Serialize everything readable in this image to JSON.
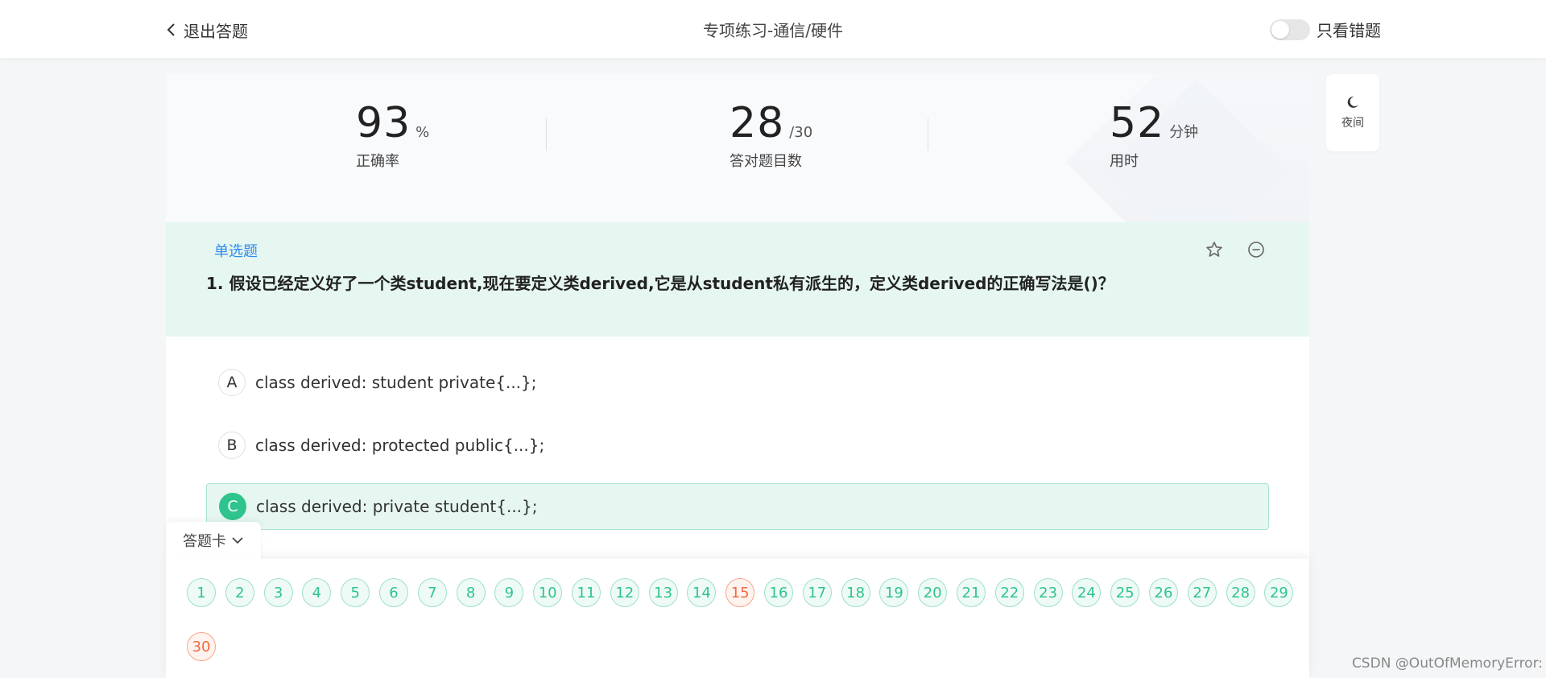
{
  "header": {
    "back_label": "退出答题",
    "title": "专项练习-通信/硬件",
    "wrong_only_label": "只看错题",
    "wrong_only_on": false
  },
  "stats": [
    {
      "value": "93",
      "unit": "%",
      "label": "正确率"
    },
    {
      "value": "28",
      "unit": "/30",
      "label": "答对题目数"
    },
    {
      "value": "52",
      "unit": "分钟",
      "label": "用时"
    }
  ],
  "question": {
    "type": "单选题",
    "text": "1. 假设已经定义好了一个类student,现在要定义类derived,它是从student私有派生的，定义类derived的正确写法是()？",
    "options": [
      {
        "letter": "A",
        "text": "class derived: student private{...};",
        "selected": false
      },
      {
        "letter": "B",
        "text": "class derived: protected public{...};",
        "selected": false
      },
      {
        "letter": "C",
        "text": "class derived: private student{...};",
        "selected": true
      }
    ]
  },
  "answer_card": {
    "tab_label": "答题卡",
    "numbers": [
      {
        "n": "1",
        "status": "correct"
      },
      {
        "n": "2",
        "status": "correct"
      },
      {
        "n": "3",
        "status": "correct"
      },
      {
        "n": "4",
        "status": "correct"
      },
      {
        "n": "5",
        "status": "correct"
      },
      {
        "n": "6",
        "status": "correct"
      },
      {
        "n": "7",
        "status": "correct"
      },
      {
        "n": "8",
        "status": "correct"
      },
      {
        "n": "9",
        "status": "correct"
      },
      {
        "n": "10",
        "status": "correct"
      },
      {
        "n": "11",
        "status": "correct"
      },
      {
        "n": "12",
        "status": "correct"
      },
      {
        "n": "13",
        "status": "correct"
      },
      {
        "n": "14",
        "status": "correct"
      },
      {
        "n": "15",
        "status": "wrong"
      },
      {
        "n": "16",
        "status": "correct"
      },
      {
        "n": "17",
        "status": "correct"
      },
      {
        "n": "18",
        "status": "correct"
      },
      {
        "n": "19",
        "status": "correct"
      },
      {
        "n": "20",
        "status": "correct"
      },
      {
        "n": "21",
        "status": "correct"
      },
      {
        "n": "22",
        "status": "correct"
      },
      {
        "n": "23",
        "status": "correct"
      },
      {
        "n": "24",
        "status": "correct"
      },
      {
        "n": "25",
        "status": "correct"
      },
      {
        "n": "26",
        "status": "correct"
      },
      {
        "n": "27",
        "status": "correct"
      },
      {
        "n": "28",
        "status": "correct"
      },
      {
        "n": "29",
        "status": "correct"
      },
      {
        "n": "30",
        "status": "wrong"
      }
    ]
  },
  "night_mode_label": "夜间",
  "watermark": "CSDN @OutOfMemoryError:",
  "colors": {
    "accent": "#2fc48d",
    "wrong": "#f06a41",
    "question_bg": "#e6f6f1",
    "type_blue": "#2d8cf0"
  },
  "icons": {
    "back": "chevron-left-icon",
    "favorite": "star-icon",
    "remove": "minus-circle-icon",
    "collapse": "chevron-down-icon",
    "night": "moon-icon"
  }
}
